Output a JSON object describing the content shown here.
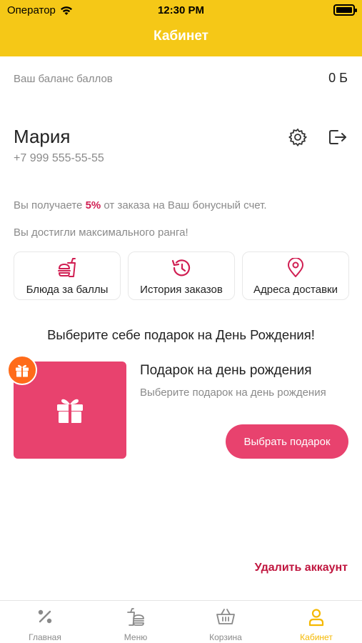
{
  "status_bar": {
    "carrier": "Оператор",
    "time": "12:30 PM"
  },
  "header": {
    "title": "Кабинет"
  },
  "balance": {
    "label": "Ваш баланс баллов",
    "value": "0 Б"
  },
  "user": {
    "name": "Мария",
    "phone": "+7 999 555-55-55"
  },
  "bonus_info": {
    "prefix": "Вы получаете ",
    "percent": "5%",
    "suffix": " от заказа на Ваш бонусный счет.",
    "rank_text": "Вы достигли максимального ранга!"
  },
  "cards": [
    {
      "label": "Блюда за баллы",
      "icon": "food-icon"
    },
    {
      "label": "История заказов",
      "icon": "history-icon"
    },
    {
      "label": "Адреса доставки",
      "icon": "location-pin-icon"
    }
  ],
  "birthday": {
    "heading": "Выберите себе подарок на День Рождения!",
    "gift_title": "Подарок на день рождения",
    "gift_subtitle": "Выберите подарок на день рождения",
    "button": "Выбрать подарок"
  },
  "delete_account": "Удалить аккаунт",
  "tabs": [
    {
      "label": "Главная",
      "icon": "percent-icon",
      "active": false
    },
    {
      "label": "Меню",
      "icon": "menu-icon",
      "active": false
    },
    {
      "label": "Корзина",
      "icon": "basket-icon",
      "active": false
    },
    {
      "label": "Кабинет",
      "icon": "user-icon",
      "active": true
    }
  ],
  "colors": {
    "header": "#f5c817",
    "accent": "#e8426e",
    "accent_text": "#d01e52",
    "badge": "#ff6b1a",
    "active_tab": "#f5b800"
  }
}
